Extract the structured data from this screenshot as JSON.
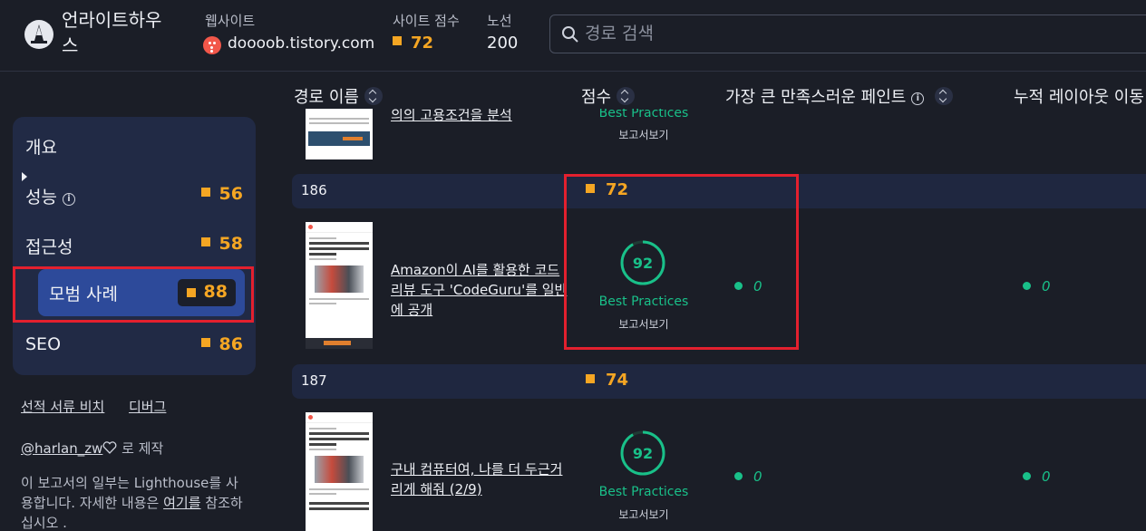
{
  "header": {
    "brand": "언라이트하우스",
    "website_label": "웹사이트",
    "website": "doooob.tistory.com",
    "site_score_label": "사이트 점수",
    "site_score": "72",
    "routes_label": "노선",
    "routes": "200",
    "search_placeholder": "경로 검색"
  },
  "sidebar": {
    "items": [
      {
        "label": "개요",
        "score": ""
      },
      {
        "label": "성능",
        "score": "56"
      },
      {
        "label": "접근성",
        "score": "58"
      },
      {
        "label": "모범 사례",
        "score": "88"
      },
      {
        "label": "SEO",
        "score": "86"
      }
    ],
    "links": [
      "선적 서류 비치",
      "디버그"
    ],
    "made_by_user": "@harlan_zw",
    "made_by_suffix": "로 제작",
    "footer_text_1": "이 보고서의 일부는 Lighthouse를 사용합니다. 자세한 내용은",
    "footer_link": "여기를",
    "footer_text_2": "참조하십시오 ."
  },
  "table": {
    "columns": [
      "경로 이름",
      "점수",
      "가장 큰 만족스러운 페인트",
      "누적 레이아웃 이동"
    ],
    "partial_row": {
      "path": "의의 고용조건을 분석",
      "category": "Best Practices",
      "report": "보고서보기"
    },
    "groups": [
      {
        "num": "186",
        "score": "72",
        "path": "Amazon이 AI를 활용한 코드 리뷰 도구 'CodeGuru'를 일반에 공개",
        "bp_score": "92",
        "category": "Best Practices",
        "report": "보고서보기",
        "lcp": "0",
        "cls": "0"
      },
      {
        "num": "187",
        "score": "74",
        "path": "구내 컴퓨터여, 나를 더 두근거리게 해줘 (2/9)",
        "bp_score": "92",
        "category": "Best Practices",
        "report": "보고서보기",
        "lcp": "0",
        "cls": "0"
      }
    ]
  },
  "colors": {
    "background": "#1b1e27",
    "sidebar": "#212a45",
    "active": "#2d4a9a",
    "orange": "#f5a623",
    "green": "#19c089",
    "highlight": "#e3202e"
  }
}
